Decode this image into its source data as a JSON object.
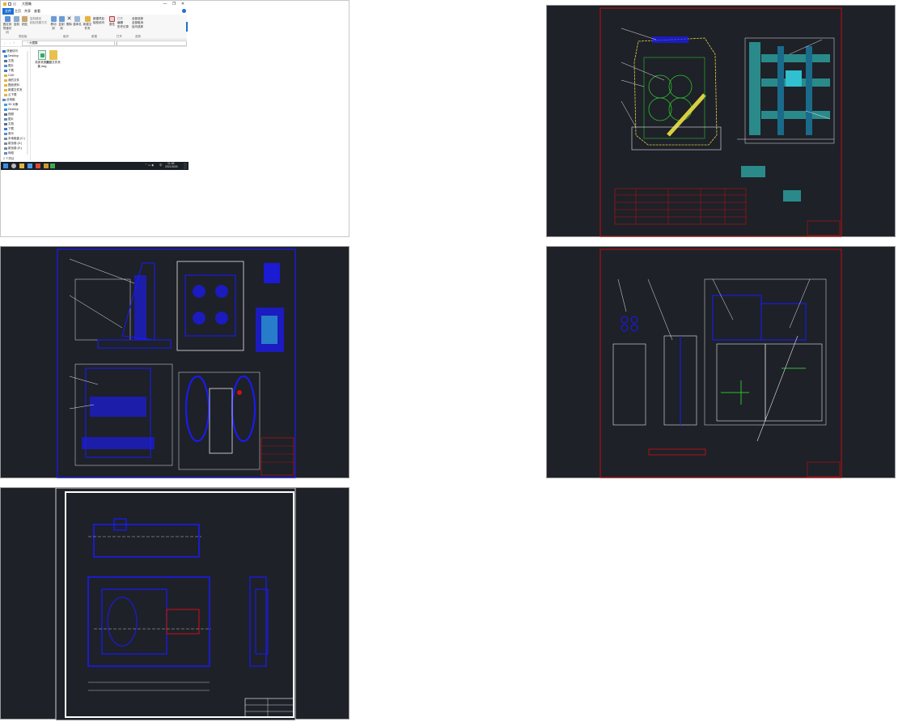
{
  "explorer": {
    "title": "大图集",
    "window_controls": [
      "—",
      "❐",
      "✕"
    ],
    "tabs": [
      "文件",
      "主页",
      "共享",
      "查看"
    ],
    "active_tab": "文件",
    "ribbon": {
      "buttons": [
        {
          "label": "固定到快速访问",
          "icon": "pin-icon"
        },
        {
          "label": "复制",
          "icon": "copy-icon"
        },
        {
          "label": "粘贴",
          "icon": "paste-icon"
        },
        {
          "label": "移动到",
          "icon": "move-icon"
        },
        {
          "label": "复制到",
          "icon": "copy-to-icon"
        },
        {
          "label": "删除",
          "icon": "delete-icon"
        },
        {
          "label": "重命名",
          "icon": "rename-icon"
        },
        {
          "label": "新建文件夹",
          "icon": "new-folder-icon"
        },
        {
          "label": "属性",
          "icon": "properties-icon"
        },
        {
          "label": "全部选择",
          "icon": "select-all-icon"
        }
      ],
      "small_items": [
        "复制路径",
        "粘贴快捷方式",
        "新建项目",
        "轻松访问",
        "打开",
        "编辑",
        "历史记录",
        "全部取消",
        "反向选择"
      ],
      "groups": [
        "剪贴板",
        "组织",
        "新建",
        "打开",
        "选择"
      ]
    },
    "address": "› 大图集",
    "nav": {
      "items": [
        {
          "label": "快速访问",
          "color": "#2a72d6"
        },
        {
          "label": "Desktop",
          "color": "#3a8ee6"
        },
        {
          "label": "文档",
          "color": "#5a6f8a"
        },
        {
          "label": "图片",
          "color": "#5a8ad0"
        },
        {
          "label": "下载",
          "color": "#3a7bd5"
        },
        {
          "label": "CAD",
          "color": "#e3b341"
        },
        {
          "label": "我的文件",
          "color": "#e3b341"
        },
        {
          "label": "图纸资料",
          "color": "#e3b341"
        },
        {
          "label": "新建文件夹",
          "color": "#e3b341"
        },
        {
          "label": "云下载",
          "color": "#e3b341"
        },
        {
          "label": "此电脑",
          "color": "#5a8ad0"
        },
        {
          "label": "3D 对象",
          "color": "#3aa1d6"
        },
        {
          "label": "Desktop",
          "color": "#3a8ee6"
        },
        {
          "label": "视频",
          "color": "#5a6f8a"
        },
        {
          "label": "图片",
          "color": "#5a8ad0"
        },
        {
          "label": "文档",
          "color": "#5a6f8a"
        },
        {
          "label": "下载",
          "color": "#3a7bd5"
        },
        {
          "label": "音乐",
          "color": "#5a8ad0"
        },
        {
          "label": "本地磁盘 (C:)",
          "color": "#7a8a99"
        },
        {
          "label": "新加卷 (D:)",
          "color": "#7a8a99"
        },
        {
          "label": "新加卷 (E:)",
          "color": "#7a8a99"
        },
        {
          "label": "网络",
          "color": "#5a8ad0"
        }
      ]
    },
    "files": [
      {
        "name": "机床夹具图集.dwg",
        "icon": "dwg-file-icon"
      },
      {
        "name": "新建文件夹",
        "icon": "folder-icon"
      }
    ],
    "status": "2 个项目",
    "taskbar": {
      "tray": "中",
      "time": "11:48",
      "date": "2021/5/26"
    }
  },
  "colors": {
    "accent": "#1e6fd1",
    "cad_background": "#1e2128",
    "cad_blue": "#1a1aff",
    "cad_red": "#d01010",
    "cad_white": "#e8e8e8",
    "cad_cyan": "#30c0d0",
    "cad_yellow": "#d8d040",
    "cad_green": "#30c030",
    "cad_teal": "#2a8a8a"
  },
  "drawings": [
    {
      "id": "drawing-1"
    },
    {
      "id": "drawing-2"
    },
    {
      "id": "drawing-3"
    },
    {
      "id": "drawing-4"
    },
    {
      "id": "drawing-5"
    }
  ]
}
